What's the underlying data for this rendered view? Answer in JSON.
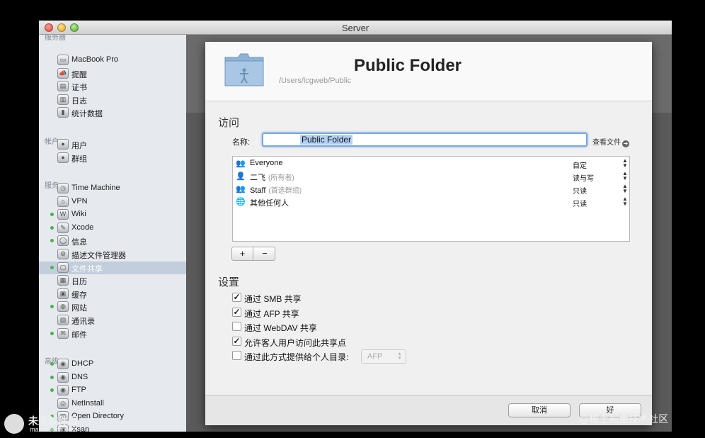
{
  "window": {
    "title": "Server"
  },
  "sidebar": {
    "section_server": "服务器",
    "server_items": [
      {
        "label": "MacBook Pro",
        "icon": "laptop-icon"
      },
      {
        "label": "提醒",
        "icon": "megaphone-icon"
      },
      {
        "label": "证书",
        "icon": "certificate-icon"
      },
      {
        "label": "日志",
        "icon": "log-icon"
      },
      {
        "label": "统计数据",
        "icon": "stats-icon"
      }
    ],
    "section_accounts": "帐户",
    "account_items": [
      {
        "label": "用户",
        "icon": "user-icon"
      },
      {
        "label": "群组",
        "icon": "group-icon"
      }
    ],
    "section_services": "服务",
    "service_items": [
      {
        "label": "Time Machine",
        "icon": "time-machine-icon",
        "status": false
      },
      {
        "label": "VPN",
        "icon": "vpn-icon",
        "status": false
      },
      {
        "label": "Wiki",
        "icon": "wiki-icon",
        "status": true
      },
      {
        "label": "Xcode",
        "icon": "xcode-icon",
        "status": true
      },
      {
        "label": "信息",
        "icon": "messages-icon",
        "status": true
      },
      {
        "label": "描述文件管理器",
        "icon": "profile-manager-icon",
        "status": false
      },
      {
        "label": "文件共享",
        "icon": "file-sharing-icon",
        "status": true,
        "selected": true
      },
      {
        "label": "日历",
        "icon": "calendar-icon",
        "status": false
      },
      {
        "label": "缓存",
        "icon": "caching-icon",
        "status": false
      },
      {
        "label": "网站",
        "icon": "websites-icon",
        "status": true
      },
      {
        "label": "通讯录",
        "icon": "contacts-icon",
        "status": false
      },
      {
        "label": "邮件",
        "icon": "mail-icon",
        "status": true
      }
    ],
    "section_advanced": "高级",
    "advanced_items": [
      {
        "label": "DHCP",
        "icon": "dhcp-icon",
        "status": true
      },
      {
        "label": "DNS",
        "icon": "dns-icon",
        "status": true
      },
      {
        "label": "FTP",
        "icon": "ftp-icon",
        "status": true
      },
      {
        "label": "NetInstall",
        "icon": "netinstall-icon",
        "status": false
      },
      {
        "label": "Open Directory",
        "icon": "open-directory-icon",
        "status": true
      },
      {
        "label": "Xsan",
        "icon": "xsan-icon",
        "status": true
      }
    ]
  },
  "sheet": {
    "title": "Public Folder",
    "path": "/Users/lcgweb/Public",
    "access_heading": "访问",
    "name_label": "名称:",
    "name_value": "Public Folder",
    "view_files": "查看文件",
    "permissions": [
      {
        "icon": "group-icon",
        "name": "Everyone",
        "note": "",
        "value": "自定"
      },
      {
        "icon": "user-icon",
        "name": "二飞",
        "note": "(所有者)",
        "value": "读与写"
      },
      {
        "icon": "group-icon",
        "name": "Staff",
        "note": "(首选群组)",
        "value": "只读"
      },
      {
        "icon": "globe-icon",
        "name": "其他任何人",
        "note": "",
        "value": "只读"
      }
    ],
    "add_label": "+",
    "remove_label": "−",
    "settings_heading": "设置",
    "options": [
      {
        "label": "通过 SMB 共享",
        "checked": true
      },
      {
        "label": "通过 AFP 共享",
        "checked": true
      },
      {
        "label": "通过 WebDAV 共享",
        "checked": false
      },
      {
        "label": "允许客人用户访问此共享点",
        "checked": true
      },
      {
        "label": "通过此方式提供给个人目录:",
        "checked": false
      }
    ],
    "home_protocol": "AFP",
    "cancel_label": "取消",
    "ok_label": "好"
  },
  "watermarks": {
    "left_title": "未来软件园",
    "left_url": "mac.orsoon.com",
    "right": "@稀土掘金技术社区"
  },
  "colors": {
    "selection": "#c3cedd",
    "status_dot": "#47b34a",
    "focus_ring": "#7aa7e0"
  }
}
